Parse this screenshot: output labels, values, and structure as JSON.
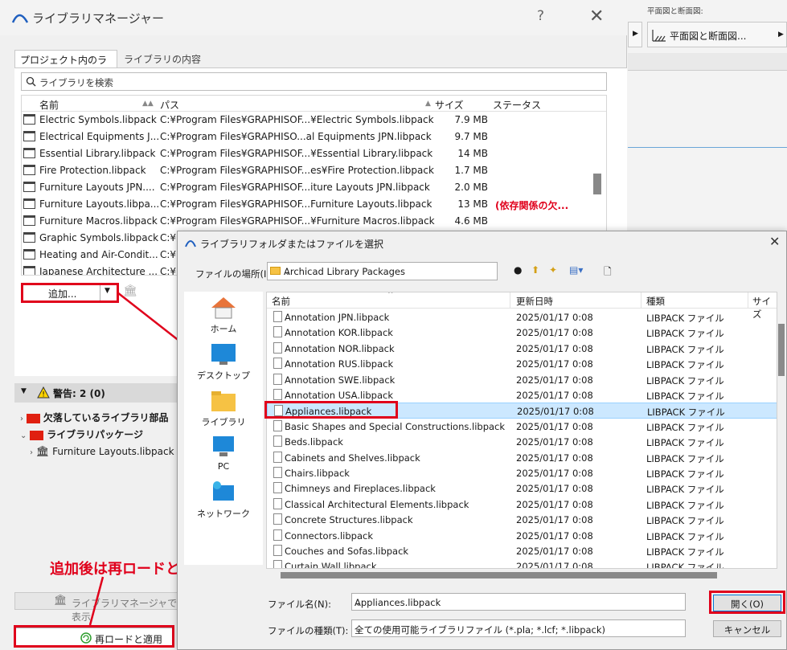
{
  "libmgr": {
    "title": "ライブラリマネージャー",
    "help": "?",
    "close": "✕",
    "tabs": [
      "プロジェクト内のライブラリ",
      "ライブラリの内容"
    ],
    "search_placeholder": "ライブラリを検索",
    "columns": [
      "名前",
      "パス",
      "サイズ",
      "ステータス"
    ],
    "rows": [
      {
        "name": "Electric Symbols.libpack",
        "path": "C:¥Program Files¥GRAPHISOF...¥Electric Symbols.libpack",
        "size": "7.9 MB",
        "status": ""
      },
      {
        "name": "Electrical Equipments J...",
        "path": "C:¥Program Files¥GRAPHISO...al Equipments JPN.libpack",
        "size": "9.7 MB",
        "status": ""
      },
      {
        "name": "Essential Library.libpack",
        "path": "C:¥Program Files¥GRAPHISOF...¥Essential Library.libpack",
        "size": "14 MB",
        "status": ""
      },
      {
        "name": "Fire Protection.libpack",
        "path": "C:¥Program Files¥GRAPHISOF...es¥Fire Protection.libpack",
        "size": "1.7 MB",
        "status": ""
      },
      {
        "name": "Furniture Layouts JPN....",
        "path": "C:¥Program Files¥GRAPHISOF...iture Layouts JPN.libpack",
        "size": "2.0 MB",
        "status": ""
      },
      {
        "name": "Furniture Layouts.libpa...",
        "path": "C:¥Program Files¥GRAPHISOF...Furniture Layouts.libpack",
        "size": "13 MB",
        "status": "(依存関係の欠..."
      },
      {
        "name": "Furniture Macros.libpack",
        "path": "C:¥Program Files¥GRAPHISOF...¥Furniture Macros.libpack",
        "size": "4.6 MB",
        "status": ""
      },
      {
        "name": "Graphic Symbols.libpack",
        "path": "C:¥",
        "size": "",
        "status": ""
      },
      {
        "name": "Heating and Air-Condit...",
        "path": "C:¥",
        "size": "",
        "status": ""
      },
      {
        "name": "Japanese Architecture ...",
        "path": "C:¥",
        "size": "",
        "status": ""
      }
    ],
    "add_button": "追加...",
    "warning": "警告: 2 (0)",
    "tree": [
      "欠落しているライブラリ部品",
      "ライブラリパッケージ",
      "Furniture Layouts.libpack"
    ],
    "annotation": "追加後は再ロードと適用",
    "show_in_libmgr": "ライブラリマネージャで表示",
    "reload_apply": "再ロードと適用",
    "colors": {
      "accent_red": "#e0001b",
      "status_red": "#e0001b"
    }
  },
  "right_top": {
    "label": "平面図と断面図:",
    "dropdown": "平面図と断面図..."
  },
  "dialog": {
    "title": "ライブラリフォルダまたはファイルを選択",
    "location_label": "ファイルの場所(I):",
    "location_value": "Archicad Library Packages",
    "places": [
      "ホーム",
      "デスクトップ",
      "ライブラリ",
      "PC",
      "ネットワーク"
    ],
    "columns": [
      "名前",
      "更新日時",
      "種類",
      "サイズ"
    ],
    "files": [
      {
        "name": "Annotation JPN.libpack",
        "date": "2025/01/17 0:08",
        "type": "LIBPACK ファイル"
      },
      {
        "name": "Annotation KOR.libpack",
        "date": "2025/01/17 0:08",
        "type": "LIBPACK ファイル"
      },
      {
        "name": "Annotation NOR.libpack",
        "date": "2025/01/17 0:08",
        "type": "LIBPACK ファイル"
      },
      {
        "name": "Annotation RUS.libpack",
        "date": "2025/01/17 0:08",
        "type": "LIBPACK ファイル"
      },
      {
        "name": "Annotation SWE.libpack",
        "date": "2025/01/17 0:08",
        "type": "LIBPACK ファイル"
      },
      {
        "name": "Annotation USA.libpack",
        "date": "2025/01/17 0:08",
        "type": "LIBPACK ファイル"
      },
      {
        "name": "Appliances.libpack",
        "date": "2025/01/17 0:08",
        "type": "LIBPACK ファイル"
      },
      {
        "name": "Basic Shapes and Special Constructions.libpack",
        "date": "2025/01/17 0:08",
        "type": "LIBPACK ファイル"
      },
      {
        "name": "Beds.libpack",
        "date": "2025/01/17 0:08",
        "type": "LIBPACK ファイル"
      },
      {
        "name": "Cabinets and Shelves.libpack",
        "date": "2025/01/17 0:08",
        "type": "LIBPACK ファイル"
      },
      {
        "name": "Chairs.libpack",
        "date": "2025/01/17 0:08",
        "type": "LIBPACK ファイル"
      },
      {
        "name": "Chimneys and Fireplaces.libpack",
        "date": "2025/01/17 0:08",
        "type": "LIBPACK ファイル"
      },
      {
        "name": "Classical Architectural Elements.libpack",
        "date": "2025/01/17 0:08",
        "type": "LIBPACK ファイル"
      },
      {
        "name": "Concrete Structures.libpack",
        "date": "2025/01/17 0:08",
        "type": "LIBPACK ファイル"
      },
      {
        "name": "Connectors.libpack",
        "date": "2025/01/17 0:08",
        "type": "LIBPACK ファイル"
      },
      {
        "name": "Couches and Sofas.libpack",
        "date": "2025/01/17 0:08",
        "type": "LIBPACK ファイル"
      },
      {
        "name": "Curtain Wall.libpack",
        "date": "2025/01/17 0:08",
        "type": "LIBPACK ファイル"
      }
    ],
    "selected_index": 6,
    "filename_label": "ファイル名(N):",
    "filename_value": "Appliances.libpack",
    "filetype_label": "ファイルの種類(T):",
    "filetype_value": "全ての使用可能ライブラリファイル (*.pla; *.lcf; *.libpack)",
    "open_button": "開く(O)",
    "cancel_button": "キャンセル"
  }
}
